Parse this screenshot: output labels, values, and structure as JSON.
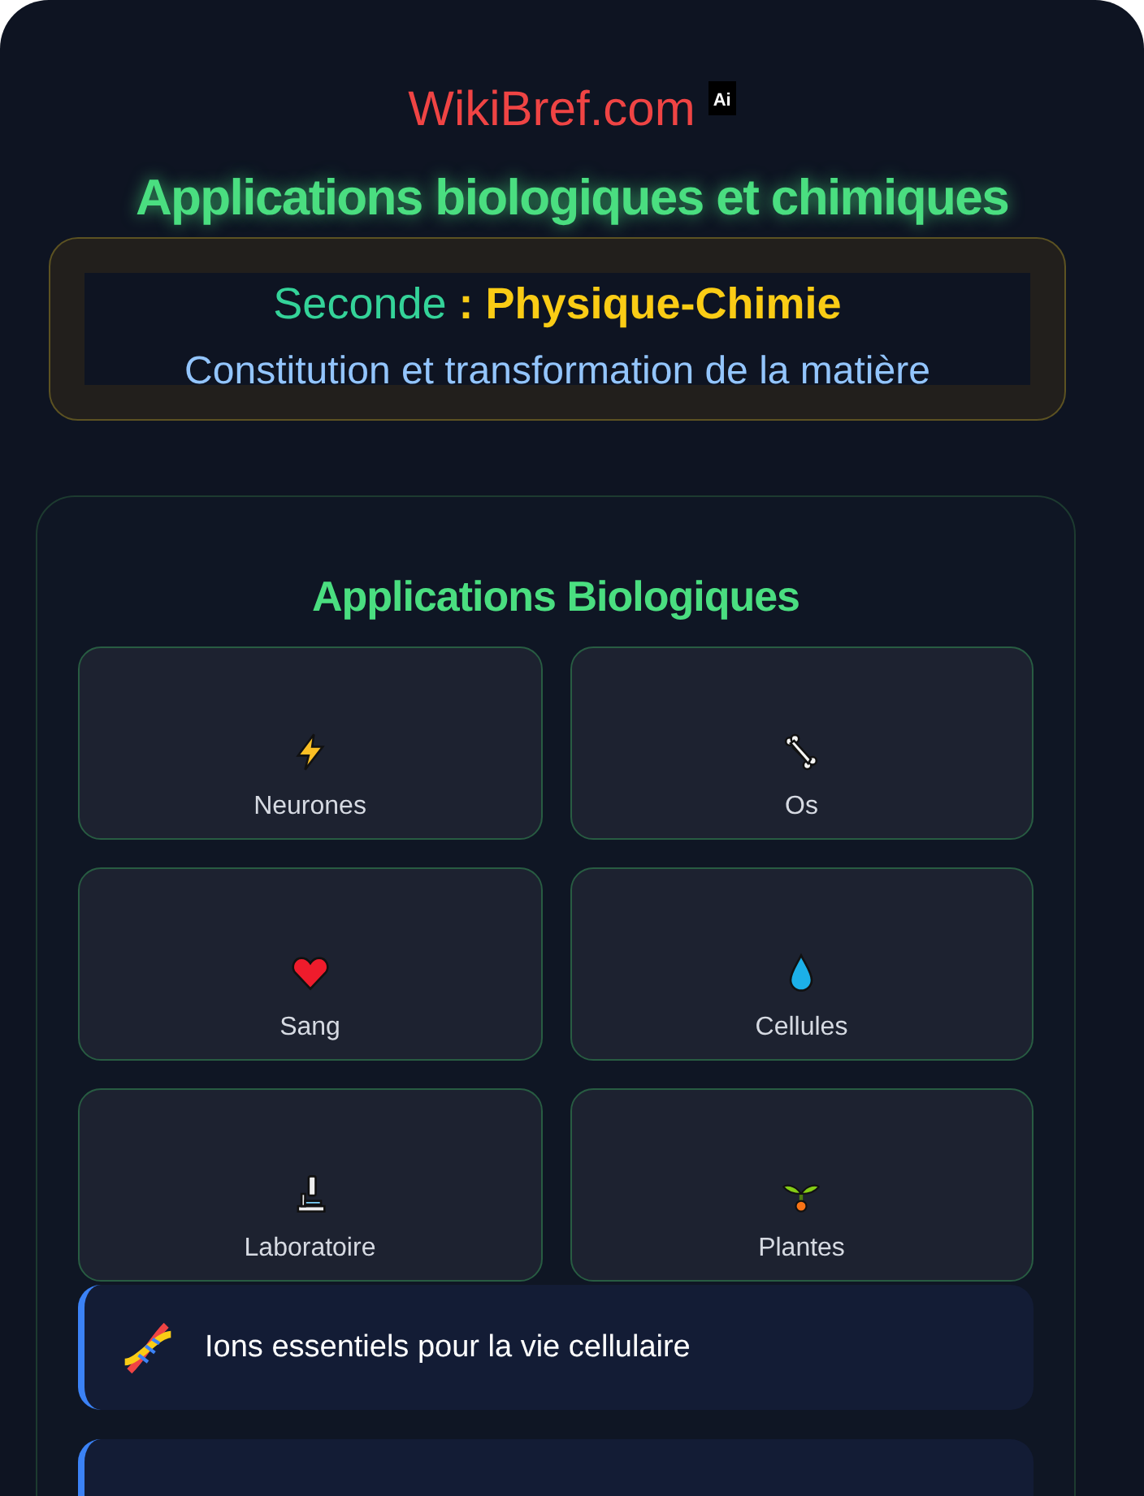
{
  "header": {
    "site": "WikiBref.com",
    "badge": "Ai",
    "title": "Applications biologiques et chimiques"
  },
  "subject": {
    "level": "Seconde",
    "separator": ":",
    "name": "Physique-Chimie",
    "topic": "Constitution et transformation de la matière"
  },
  "section": {
    "title": "Applications Biologiques",
    "cards": [
      {
        "label": "Neurones"
      },
      {
        "label": "Os"
      },
      {
        "label": "Sang"
      },
      {
        "label": "Cellules"
      },
      {
        "label": "Laboratoire"
      },
      {
        "label": "Plantes"
      }
    ],
    "notes": [
      {
        "text": "Ions essentiels pour la vie cellulaire"
      }
    ]
  }
}
